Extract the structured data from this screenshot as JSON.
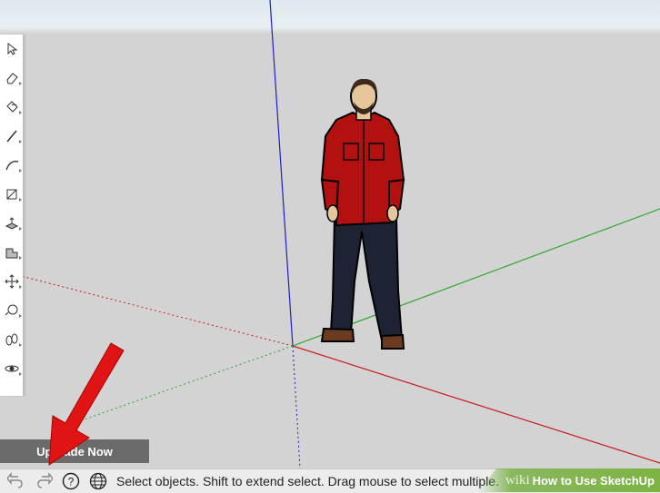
{
  "viewport": {
    "name": "3d-viewport"
  },
  "toolbar": {
    "tools": [
      {
        "name": "select-tool",
        "icon": "arrow-pointer-icon"
      },
      {
        "name": "eraser-tool",
        "icon": "eraser-icon"
      },
      {
        "name": "paint-bucket-tool",
        "icon": "paint-bucket-icon"
      },
      {
        "name": "line-tool",
        "icon": "pencil-icon"
      },
      {
        "name": "arc-tool",
        "icon": "arc-icon"
      },
      {
        "name": "rectangle-tool",
        "icon": "rectangle-icon"
      },
      {
        "name": "push-pull-tool",
        "icon": "push-pull-icon"
      },
      {
        "name": "offset-tool",
        "icon": "offset-icon"
      },
      {
        "name": "move-tool",
        "icon": "move-icon"
      },
      {
        "name": "rotate-tool",
        "icon": "tape-measure-icon"
      },
      {
        "name": "footprint-tool",
        "icon": "footprints-icon"
      },
      {
        "name": "orbit-tool",
        "icon": "orbit-icon"
      }
    ]
  },
  "upgrade": {
    "label": "Upgrade Now"
  },
  "statusbar": {
    "icons": [
      "undo-icon",
      "redo-icon",
      "help-icon",
      "globe-icon"
    ],
    "message": "Select objects. Shift to extend select. Drag mouse to select multiple."
  },
  "watermark": {
    "wiki": "wiki",
    "title": "How to Use SketchUp"
  },
  "colors": {
    "accent_arrow": "#e01414",
    "axis_blue": "#1d1dcf",
    "axis_red": "#c81a1a",
    "axis_green": "#2aa82a",
    "watermark_green": "#7cb342"
  }
}
